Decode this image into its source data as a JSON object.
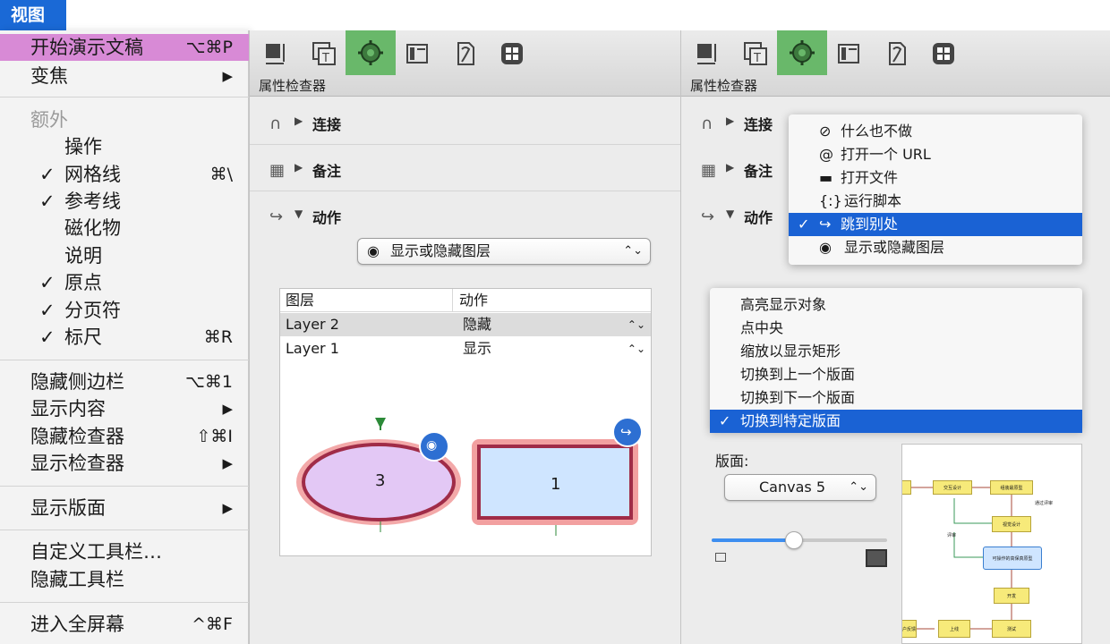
{
  "menubar": {
    "title": "视图"
  },
  "menu": {
    "start_presentation": {
      "label": "开始演示文稿",
      "shortcut": "⌥⌘P"
    },
    "zoom": {
      "label": "变焦"
    },
    "extras": {
      "label": "额外"
    },
    "actions": {
      "label": "操作"
    },
    "grid": {
      "label": "网格线",
      "shortcut": "⌘\\"
    },
    "guides": {
      "label": "参考线"
    },
    "magnets": {
      "label": "磁化物"
    },
    "notes": {
      "label": "说明"
    },
    "origin": {
      "label": "原点"
    },
    "page_breaks": {
      "label": "分页符"
    },
    "rulers": {
      "label": "标尺",
      "shortcut": "⌘R"
    },
    "hide_sidebar": {
      "label": "隐藏侧边栏",
      "shortcut": "⌥⌘1"
    },
    "show_contents": {
      "label": "显示内容"
    },
    "hide_inspectors": {
      "label": "隐藏检查器",
      "shortcut": "⇧⌘I"
    },
    "show_inspectors": {
      "label": "显示检查器"
    },
    "show_canvases": {
      "label": "显示版面"
    },
    "customize_toolbar": {
      "label": "自定义工具栏…"
    },
    "hide_toolbar": {
      "label": "隐藏工具栏"
    },
    "enter_fullscreen": {
      "label": "进入全屏幕",
      "shortcut": "^⌘F"
    },
    "check": "✓",
    "arrow": "▶"
  },
  "inspector": {
    "title": "属性检查器",
    "sections": {
      "connections": "连接",
      "notes": "备注",
      "action": "动作"
    }
  },
  "left_panel": {
    "action_popup": "显示或隐藏图层",
    "table_headers": {
      "layer": "图层",
      "action": "动作"
    },
    "rows": [
      {
        "layer": "Layer 2",
        "action": "隐藏"
      },
      {
        "layer": "Layer 1",
        "action": "显示"
      }
    ],
    "shapes": {
      "ellipse_label": "3",
      "rect_label": "1"
    }
  },
  "right_panel": {
    "action_menu": [
      {
        "icon": "⊘",
        "label": "什么也不做",
        "selected": false
      },
      {
        "icon": "@",
        "label": "打开一个 URL",
        "selected": false
      },
      {
        "icon": "▬",
        "label": "打开文件",
        "selected": false
      },
      {
        "icon": "{:}",
        "label": "运行脚本",
        "selected": false
      },
      {
        "icon": "↪",
        "label": "跳到别处",
        "selected": true
      },
      {
        "icon": "◉",
        "label": "显示或隐藏图层",
        "selected": false
      }
    ],
    "jump_menu": [
      {
        "label": "高亮显示对象",
        "selected": false
      },
      {
        "label": "点中央",
        "selected": false
      },
      {
        "label": "缩放以显示矩形",
        "selected": false
      },
      {
        "label": "切换到上一个版面",
        "selected": false
      },
      {
        "label": "切换到下一个版面",
        "selected": false
      },
      {
        "label": "切换到特定版面",
        "selected": true
      }
    ],
    "canvas_label": "版面:",
    "canvas_popup": "Canvas 5",
    "slider_value": 0.47,
    "flow_nodes": {
      "n1": "交互设计",
      "n2": "组装最原型",
      "n3": "视觉设计",
      "n4": "可操作的高保真原型",
      "n5": "开发",
      "n6": "测试",
      "n7": "上线",
      "n8": "用户反馈"
    },
    "flow_labels": {
      "pass": "通过评审",
      "review": "评审"
    }
  },
  "colors": {
    "accent": "#1a62d4",
    "highlight": "#d88ad6",
    "toolbar_selected": "#69b86a"
  }
}
